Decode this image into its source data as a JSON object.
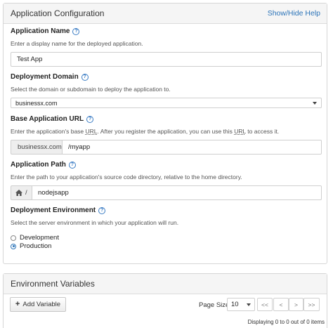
{
  "config_panel": {
    "title": "Application Configuration",
    "help_toggle": "Show/Hide Help",
    "app_name": {
      "label": "Application Name",
      "description": "Enter a display name for the deployed application.",
      "value": "Test App"
    },
    "domain": {
      "label": "Deployment Domain",
      "description": "Select the domain or subdomain to deploy the application to.",
      "selected": "businessx.com"
    },
    "base_url": {
      "label": "Base Application URL",
      "description_pre": "Enter the application's base ",
      "description_url1": "URL",
      "description_mid": ". After you register the application, you can use this ",
      "description_url2": "URL",
      "description_post": " to access it.",
      "prefix": "businessx.com",
      "value": "/myapp"
    },
    "app_path": {
      "label": "Application Path",
      "description": "Enter the path to your application's source code directory, relative to the home directory.",
      "prefix_sep": "/",
      "value": "nodejsapp"
    },
    "environment": {
      "label": "Deployment Environment",
      "description": "Select the server environment in which your application will run.",
      "options": [
        "Development",
        "Production"
      ],
      "selected": "Production"
    }
  },
  "env_panel": {
    "title": "Environment Variables",
    "add_button": "Add Variable",
    "page_size_label": "Page Size",
    "page_size_value": "10",
    "pager": {
      "first": "<<",
      "prev": "<",
      "next": ">",
      "last": ">>"
    },
    "status": "Displaying 0 to 0 out of 0 items"
  },
  "icons": {
    "help": "question-circle-icon",
    "home": "home-icon",
    "plus": "plus-icon",
    "dropdown": "caret-down-icon"
  },
  "colors": {
    "link": "#2a73b8",
    "panel_header": "#f5f5f5",
    "addon_bg": "#eeeeee"
  }
}
